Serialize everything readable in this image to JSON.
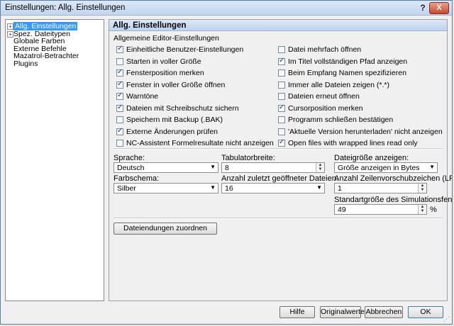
{
  "window": {
    "title": "Einstellungen: Allg. Einstellungen",
    "help_glyph": "?",
    "close_glyph": "X"
  },
  "tree": {
    "items": [
      {
        "label": "Allg. Einstellungen",
        "selected": true,
        "expander": "+"
      },
      {
        "label": "Spez. Dateitypen",
        "selected": false,
        "expander": "+"
      },
      {
        "label": "Globale Farben",
        "selected": false
      },
      {
        "label": "Externe Befehle",
        "selected": false
      },
      {
        "label": "Mazatrol-Betrachter",
        "selected": false
      },
      {
        "label": "Plugins",
        "selected": false
      }
    ]
  },
  "panel": {
    "header": "Allg. Einstellungen",
    "group_label": "Allgemeine Editor-Einstellungen",
    "left_options": [
      {
        "label": "Einheitliche Benutzer-Einstellungen",
        "checked": true
      },
      {
        "label": "Starten in voller Größe",
        "checked": false
      },
      {
        "label": "Fensterposition merken",
        "checked": true
      },
      {
        "label": "Fenster in voller Größe öffnen",
        "checked": true
      },
      {
        "label": "Warntöne",
        "checked": true
      },
      {
        "label": "Dateien mit Schreibschutz sichern",
        "checked": true
      },
      {
        "label": "Speichern mit Backup (.BAK)",
        "checked": false
      },
      {
        "label": "Externe Änderungen prüfen",
        "checked": true
      },
      {
        "label": "NC-Assistent Formelresultate nicht anzeigen",
        "checked": false
      }
    ],
    "right_options": [
      {
        "label": "Datei mehrfach öffnen",
        "checked": false
      },
      {
        "label": "Im Titel vollständigen Pfad anzeigen",
        "checked": true
      },
      {
        "label": "Beim Empfang Namen spezifizieren",
        "checked": false
      },
      {
        "label": "Immer alle Dateien zeigen (*.*)",
        "checked": false
      },
      {
        "label": "Dateien erneut öffnen",
        "checked": false
      },
      {
        "label": "Cursorposition merken",
        "checked": true
      },
      {
        "label": "Programm schließen bestätigen",
        "checked": false
      },
      {
        "label": "'Aktuelle Version herunterladen' nicht anzeigen",
        "checked": false
      },
      {
        "label": "Open files with wrapped lines read only",
        "checked": true
      }
    ],
    "sprache": {
      "label": "Sprache:",
      "value": "Deutsch"
    },
    "tabulator": {
      "label": "Tabulatorbreite:",
      "value": "8"
    },
    "dateigroesse": {
      "label": "Dateigröße anzeigen:",
      "value": "Größe anzeigen in Bytes"
    },
    "farbschema": {
      "label": "Farbschema:",
      "value": "Silber"
    },
    "zuletzt": {
      "label": "Anzahl zuletzt geöffneter Dateien:",
      "value": "16"
    },
    "zeilenvorschub": {
      "label": "Anzahl Zeilenvorschubzeichen (LF):",
      "value": "1"
    },
    "simulation": {
      "label": "Standartgröße des Simulationsfensters:",
      "value": "49",
      "unit": "%"
    },
    "dateiendungen_button": "Dateiendungen zuordnen"
  },
  "footer": {
    "help": "Hilfe",
    "defaults": "Originalwerte",
    "cancel": "Abbrechen",
    "ok": "OK"
  }
}
